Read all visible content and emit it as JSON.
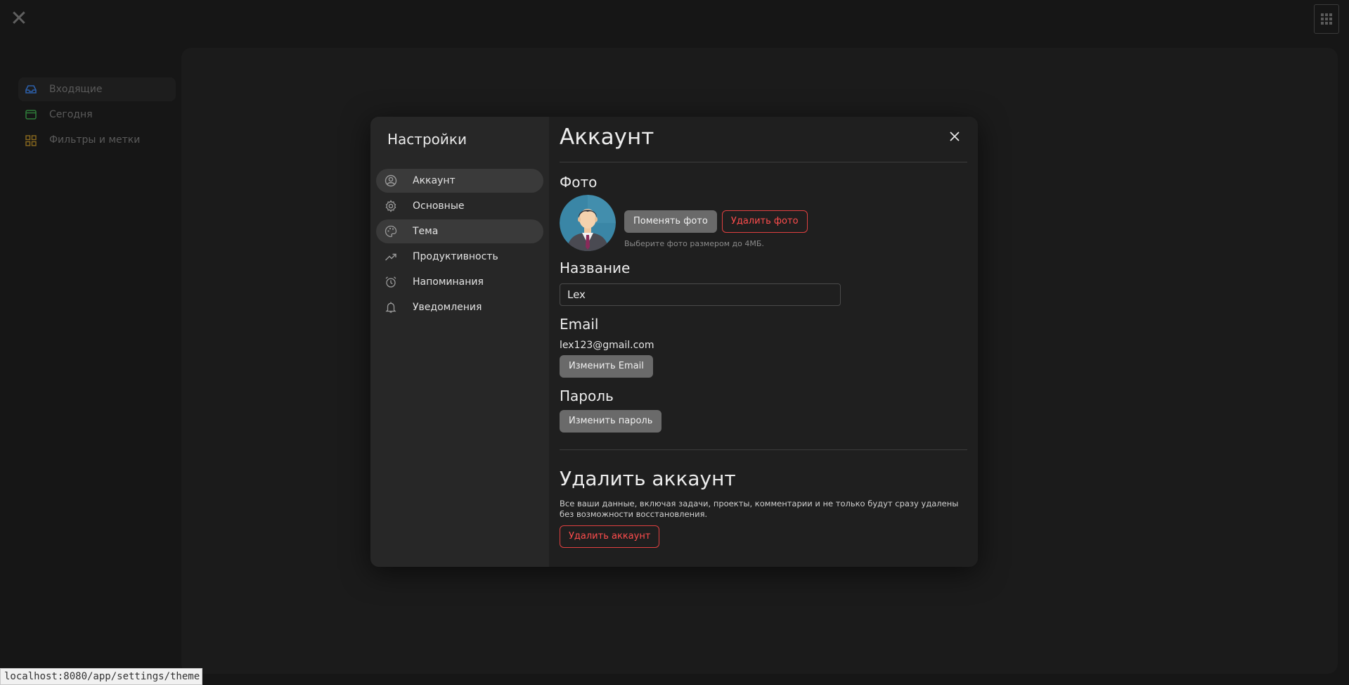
{
  "background": {
    "nav_items": [
      {
        "label": "Входящие",
        "icon": "inbox-icon",
        "color": "#2d5fa8"
      },
      {
        "label": "Сегодня",
        "icon": "calendar-icon",
        "color": "#2f7d3a"
      },
      {
        "label": "Фильтры и метки",
        "icon": "grid-icon",
        "color": "#8a6a1e"
      }
    ],
    "status_url": "localhost:8080/app/settings/theme"
  },
  "settings": {
    "title": "Настройки",
    "menu": [
      {
        "label": "Аккаунт",
        "icon": "user-circle-icon"
      },
      {
        "label": "Основные",
        "icon": "gear-icon"
      },
      {
        "label": "Тема",
        "icon": "palette-icon"
      },
      {
        "label": "Продуктивность",
        "icon": "trend-up-icon"
      },
      {
        "label": "Напоминания",
        "icon": "alarm-clock-icon"
      },
      {
        "label": "Уведомления",
        "icon": "bell-icon"
      }
    ]
  },
  "account": {
    "heading": "Аккаунт",
    "photo_title": "Фото",
    "change_photo": "Поменять фото",
    "delete_photo": "Удалить фото",
    "photo_hint": "Выберите фото размером до 4МБ.",
    "name_title": "Название",
    "name_value": "Lex",
    "email_title": "Email",
    "email_value": "lex123@gmail.com",
    "change_email": "Изменить Email",
    "password_title": "Пароль",
    "change_password": "Изменить пароль",
    "delete_title": "Удалить аккаунт",
    "delete_text": "Все ваши данные, включая задачи, проекты, комментарии и не только будут сразу удалены без возможности восстановления.",
    "delete_button": "Удалить аккаунт"
  },
  "colors": {
    "danger": "#ff4d4d",
    "active_menu": "#3a3a3a"
  }
}
